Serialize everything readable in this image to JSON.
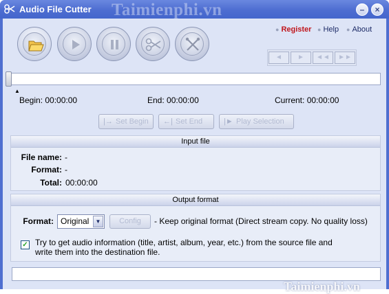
{
  "window": {
    "title": "Audio File Cutter",
    "title_icon": "scissors-app-icon",
    "watermark": "Taimienphi.vn",
    "controls": {
      "minimize": "–",
      "close": "×"
    }
  },
  "toolbar": {
    "open_icon": "folder-open-icon",
    "play_icon": "play-icon",
    "pause_icon": "pause-icon",
    "cut_icon": "scissors-icon",
    "stop_icon": "cross-tools-icon"
  },
  "links": {
    "register": "Register",
    "help": "Help",
    "about": "About"
  },
  "mini_controls": [
    "◄",
    "►",
    "◄◄",
    "►►"
  ],
  "slider": {
    "position": 0
  },
  "times": {
    "begin_label": "Begin:",
    "begin_value": "00:00:00",
    "end_label": "End:",
    "end_value": "00:00:00",
    "current_label": "Current:",
    "current_value": "00:00:00"
  },
  "actions": {
    "set_begin": "Set Begin",
    "set_end": "Set End",
    "play_selection": "Play Selection"
  },
  "input_file": {
    "header": "Input file",
    "file_name_label": "File name:",
    "file_name_value": "-",
    "format_label": "Format:",
    "format_value": "-",
    "total_label": "Total:",
    "total_value": "00:00:00"
  },
  "output_format": {
    "header": "Output format",
    "format_label": "Format:",
    "format_selected": "Original",
    "config_label": "Config",
    "format_description": "- Keep original format (Direct stream copy. No quality loss)",
    "checkbox_checked": true,
    "checkbox_line1": "Try to get audio information (title, artist, album, year, etc.) from the source file and",
    "checkbox_line2": "write them into the destination file."
  },
  "status": {
    "text": ""
  },
  "footer_watermark": "Taimienphi.vn",
  "colors": {
    "titlebar": "#4d6dd1",
    "client_bg": "#dde4f6",
    "link_accent": "#c0161c"
  }
}
